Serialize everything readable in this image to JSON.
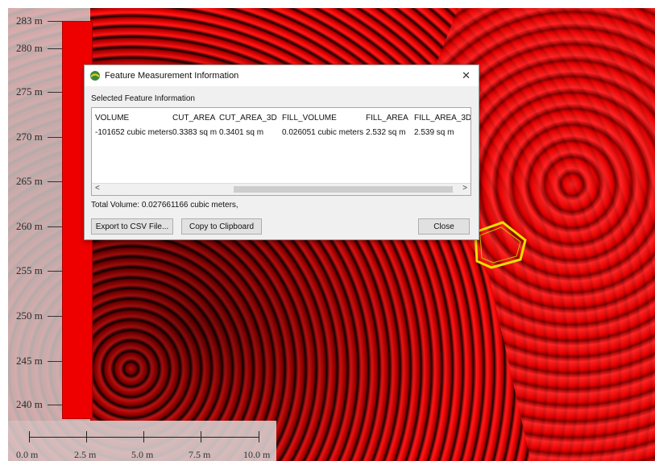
{
  "legend": {
    "ticks": [
      "283 m",
      "280 m",
      "275 m",
      "270 m",
      "265 m",
      "260 m",
      "255 m",
      "250 m",
      "245 m",
      "240 m"
    ],
    "bar_color": "#ee0000"
  },
  "scale": {
    "labels": [
      "0.0 m",
      "2.5 m",
      "5.0 m",
      "7.5 m",
      "10.0 m"
    ]
  },
  "dialog": {
    "title": "Feature Measurement Information",
    "close_glyph": "✕",
    "section_label": "Selected Feature Information",
    "columns": [
      "VOLUME",
      "CUT_AREA",
      "CUT_AREA_3D",
      "FILL_VOLUME",
      "FILL_AREA",
      "FILL_AREA_3D"
    ],
    "rows": [
      [
        "-101652 cubic meters",
        "0.3383 sq m",
        "0.3401 sq m",
        "0.026051 cubic meters",
        "2.532 sq m",
        "2.539 sq m"
      ]
    ],
    "scroll_left": "<",
    "scroll_right": ">",
    "total_volume": "Total Volume: 0.027661166 cubic meters,",
    "buttons": {
      "export": "Export to CSV File...",
      "copy": "Copy to Clipboard",
      "close": "Close"
    }
  },
  "colors": {
    "map_red": "#e00000",
    "polygon_outline": "#e8e000"
  }
}
